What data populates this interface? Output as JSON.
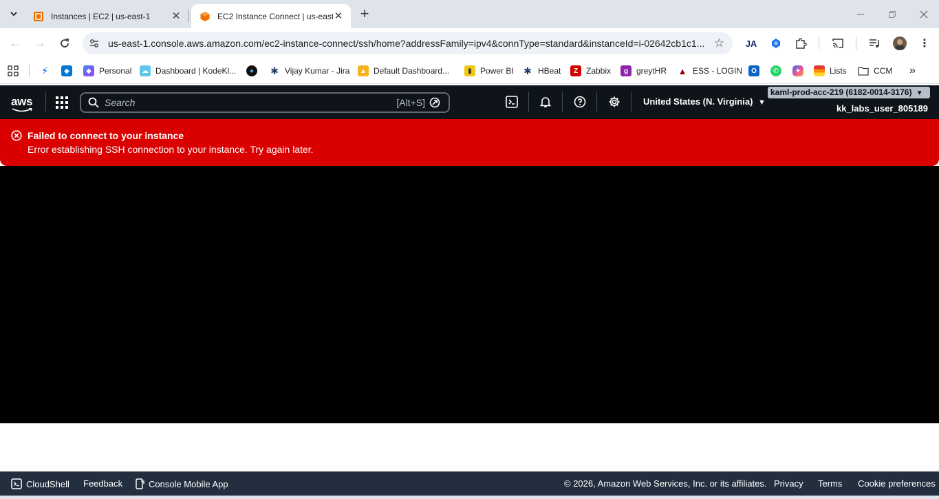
{
  "browser": {
    "tabs": [
      {
        "title": "Instances | EC2 | us-east-1",
        "active": false,
        "favicon": "aws-ec2-icon"
      },
      {
        "title": "EC2 Instance Connect | us-east-1",
        "active": true,
        "favicon": "aws-ec2-icon"
      }
    ],
    "url": "us-east-1.console.aws.amazon.com/ec2-instance-connect/ssh/home?addressFamily=ipv4&connType=standard&instanceId=i-02642cb1c1...",
    "bookmarks": [
      {
        "label": "",
        "icon": "bolt-icon"
      },
      {
        "label": "",
        "icon": "azure-devops-icon"
      },
      {
        "label": "Personal",
        "icon": "personal-icon"
      },
      {
        "label": "Dashboard | KodeKl...",
        "icon": "kodekloud-icon"
      },
      {
        "label": "",
        "icon": "eye-icon"
      },
      {
        "label": "Vijay Kumar - Jira",
        "icon": "jira-icon"
      },
      {
        "label": "Default Dashboard...",
        "icon": "dashboard-icon"
      },
      {
        "label": "Power BI",
        "icon": "powerbi-icon"
      },
      {
        "label": "HBeat",
        "icon": "hbeat-icon"
      },
      {
        "label": "Zabbix",
        "icon": "zabbix-icon"
      },
      {
        "label": "greytHR",
        "icon": "greythr-icon"
      },
      {
        "label": "ESS - LOGIN",
        "icon": "ess-icon"
      },
      {
        "label": "",
        "icon": "outlook-icon"
      },
      {
        "label": "",
        "icon": "whatsapp-icon"
      },
      {
        "label": "",
        "icon": "copilot-icon"
      },
      {
        "label": "Lists",
        "icon": "lists-icon"
      },
      {
        "label": "CCM",
        "icon": "folder-icon"
      }
    ],
    "overflow_glyph": "»"
  },
  "aws": {
    "logo": "aws",
    "search_placeholder": "Search",
    "search_shortcut": "[Alt+S]",
    "region": "United States (N. Virginia)",
    "account": "kaml-prod-acc-219 (6182-0014-3176)",
    "user": "kk_labs_user_805189"
  },
  "flash": {
    "title": "Failed to connect to your instance",
    "message": "Error establishing SSH connection to your instance. Try again later.",
    "color": "#db0000"
  },
  "footer": {
    "cloudshell": "CloudShell",
    "feedback": "Feedback",
    "mobile_app": "Console Mobile App",
    "copyright": "© 2026, Amazon Web Services, Inc. or its affiliates.",
    "privacy": "Privacy",
    "terms": "Terms",
    "cookies": "Cookie preferences"
  }
}
